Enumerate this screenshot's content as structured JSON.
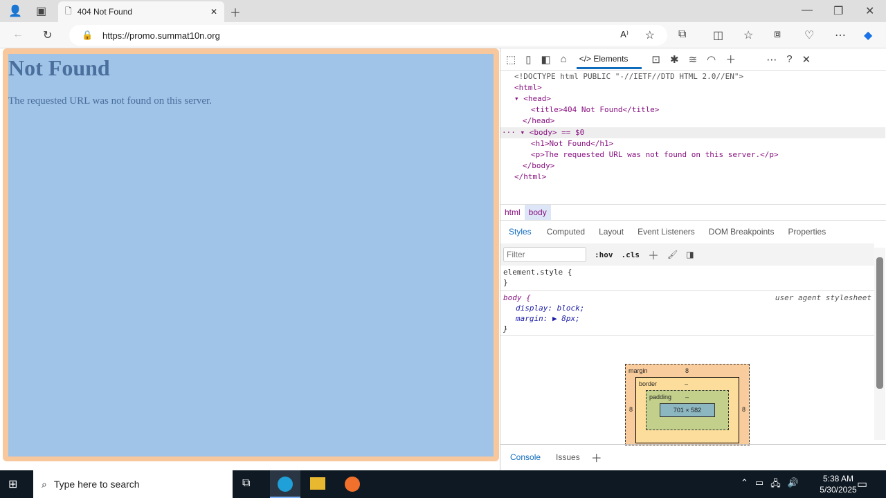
{
  "browser": {
    "tab_title": "404 Not Found",
    "url": "https://promo.summat10n.org"
  },
  "page": {
    "heading": "Not Found",
    "paragraph": "The requested URL was not found on this server."
  },
  "devtools": {
    "elements_tab": "Elements",
    "dom_lines": [
      "<!DOCTYPE html PUBLIC \"-//IETF//DTD HTML 2.0//EN\">",
      "<html>",
      "<head>",
      "<title>404 Not Found</title>",
      "</head>",
      "<body> == $0",
      "<h1>Not Found</h1>",
      "<p>The requested URL was not found on this server.</p>",
      "</body>",
      "</html>"
    ],
    "breadcrumbs": [
      "html",
      "body"
    ],
    "style_tabs": [
      "Styles",
      "Computed",
      "Layout",
      "Event Listeners",
      "DOM Breakpoints",
      "Properties"
    ],
    "filter_placeholder": "Filter",
    "hov": ":hov",
    "cls": ".cls",
    "element_style_open": "element.style {",
    "close_brace": "}",
    "rule_selector": "body {",
    "rule_source": "user agent stylesheet",
    "rule_props": [
      "display: block;",
      "margin: ▶ 8px;"
    ],
    "boxmodel": {
      "margin_label": "margin",
      "border_label": "border",
      "padding_label": "padding",
      "margin": "8",
      "dash": "–",
      "content": "701 × 582"
    },
    "drawer_tabs": [
      "Console",
      "Issues"
    ]
  },
  "taskbar": {
    "search_placeholder": "Type here to search",
    "time": "5:38 AM",
    "date": "5/30/2025"
  }
}
